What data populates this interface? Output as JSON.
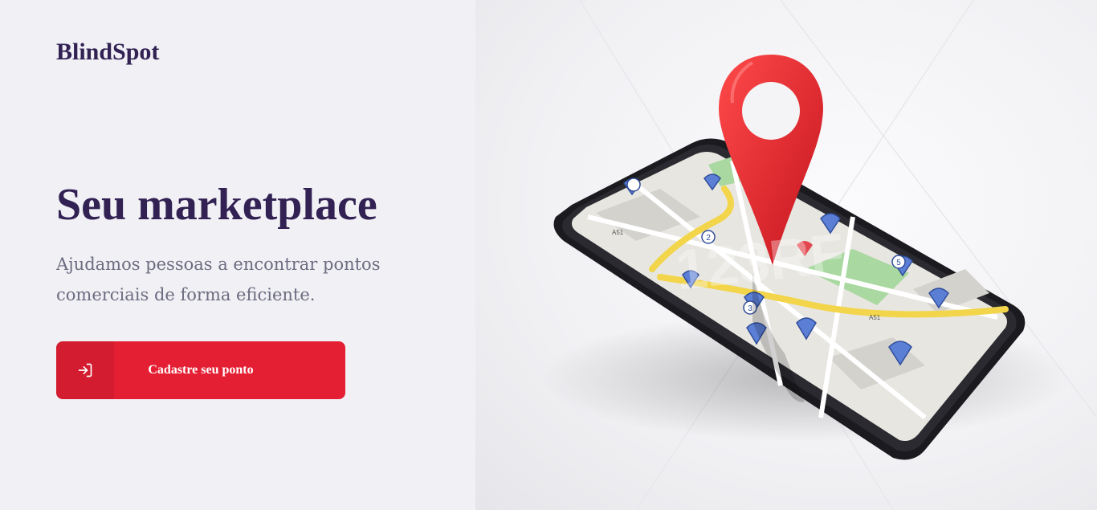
{
  "brand": {
    "name": "BlindSpot"
  },
  "hero": {
    "title": "Seu marketplace",
    "description": "Ajudamos pessoas a encontrar pontos comerciais de forma eficiente.",
    "cta_label": "Cadastre seu ponto",
    "cta_icon": "log-in-icon"
  },
  "illustration": {
    "map_road_labels": [
      "A51",
      "A51"
    ],
    "map_marker_numbers": [
      "2",
      "3",
      "3",
      "5"
    ],
    "watermark": "123RF"
  },
  "colors": {
    "primary_dark": "#322153",
    "accent_red": "#e51f33",
    "text_muted": "#6c6c80",
    "background": "#f0f0f5"
  }
}
